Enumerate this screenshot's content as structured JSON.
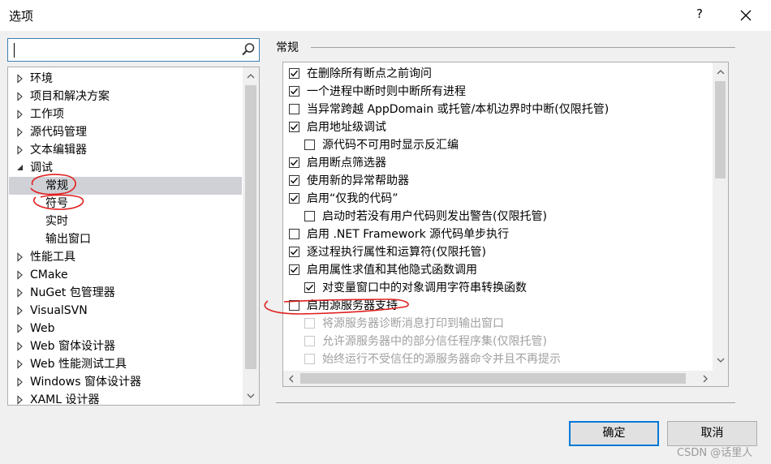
{
  "window": {
    "title": "选项",
    "help": "?",
    "close_icon": "close-icon"
  },
  "search": {
    "value": "",
    "placeholder": "",
    "icon": "search-icon"
  },
  "tree": {
    "items": [
      {
        "label": "环境",
        "expanded": false,
        "level": 0
      },
      {
        "label": "项目和解决方案",
        "expanded": false,
        "level": 0
      },
      {
        "label": "工作项",
        "expanded": false,
        "level": 0
      },
      {
        "label": "源代码管理",
        "expanded": false,
        "level": 0
      },
      {
        "label": "文本编辑器",
        "expanded": false,
        "level": 0
      },
      {
        "label": "调试",
        "expanded": true,
        "level": 0
      },
      {
        "label": "常规",
        "level": 1,
        "selected": true
      },
      {
        "label": "符号",
        "level": 1
      },
      {
        "label": "实时",
        "level": 1
      },
      {
        "label": "输出窗口",
        "level": 1
      },
      {
        "label": "性能工具",
        "expanded": false,
        "level": 0
      },
      {
        "label": "CMake",
        "expanded": false,
        "level": 0
      },
      {
        "label": "NuGet 包管理器",
        "expanded": false,
        "level": 0
      },
      {
        "label": "VisualSVN",
        "expanded": false,
        "level": 0
      },
      {
        "label": "Web",
        "expanded": false,
        "level": 0
      },
      {
        "label": "Web 窗体设计器",
        "expanded": false,
        "level": 0
      },
      {
        "label": "Web 性能测试工具",
        "expanded": false,
        "level": 0
      },
      {
        "label": "Windows 窗体设计器",
        "expanded": false,
        "level": 0
      },
      {
        "label": "XAML 设计器",
        "expanded": false,
        "level": 0
      }
    ]
  },
  "section": {
    "title": "常规"
  },
  "options": [
    {
      "label": "在删除所有断点之前询问",
      "checked": true,
      "indent": 0,
      "enabled": true
    },
    {
      "label": "一个进程中断时则中断所有进程",
      "checked": true,
      "indent": 0,
      "enabled": true
    },
    {
      "label": "当异常跨越 AppDomain 或托管/本机边界时中断(仅限托管)",
      "checked": false,
      "indent": 0,
      "enabled": true
    },
    {
      "label": "启用地址级调试",
      "checked": true,
      "indent": 0,
      "enabled": true
    },
    {
      "label": "源代码不可用时显示反汇编",
      "checked": false,
      "indent": 1,
      "enabled": true
    },
    {
      "label": "启用断点筛选器",
      "checked": true,
      "indent": 0,
      "enabled": true
    },
    {
      "label": "使用新的异常帮助器",
      "checked": true,
      "indent": 0,
      "enabled": true
    },
    {
      "label": "启用“仅我的代码”",
      "checked": true,
      "indent": 0,
      "enabled": true
    },
    {
      "label": "启动时若没有用户代码则发出警告(仅限托管)",
      "checked": false,
      "indent": 1,
      "enabled": true
    },
    {
      "label": "启用 .NET Framework 源代码单步执行",
      "checked": false,
      "indent": 0,
      "enabled": true
    },
    {
      "label": "逐过程执行属性和运算符(仅限托管)",
      "checked": true,
      "indent": 0,
      "enabled": true
    },
    {
      "label": "启用属性求值和其他隐式函数调用",
      "checked": true,
      "indent": 0,
      "enabled": true
    },
    {
      "label": "对变量窗口中的对象调用字符串转换函数",
      "checked": true,
      "indent": 1,
      "enabled": true
    },
    {
      "label": "启用源服务器支持",
      "checked": false,
      "indent": 0,
      "enabled": true
    },
    {
      "label": "将源服务器诊断消息打印到输出窗口",
      "checked": false,
      "indent": 1,
      "enabled": false
    },
    {
      "label": "允许源服务器中的部分信任程序集(仅限托管)",
      "checked": false,
      "indent": 1,
      "enabled": false
    },
    {
      "label": "始终运行不受信任的源服务器命令并且不再提示",
      "checked": false,
      "indent": 1,
      "enabled": false
    }
  ],
  "buttons": {
    "ok": "确定",
    "cancel": "取消"
  },
  "watermark": "CSDN @话里人",
  "colors": {
    "selection": "#cfd1d6",
    "accent": "#0078d7",
    "annotation": "#e02020"
  }
}
